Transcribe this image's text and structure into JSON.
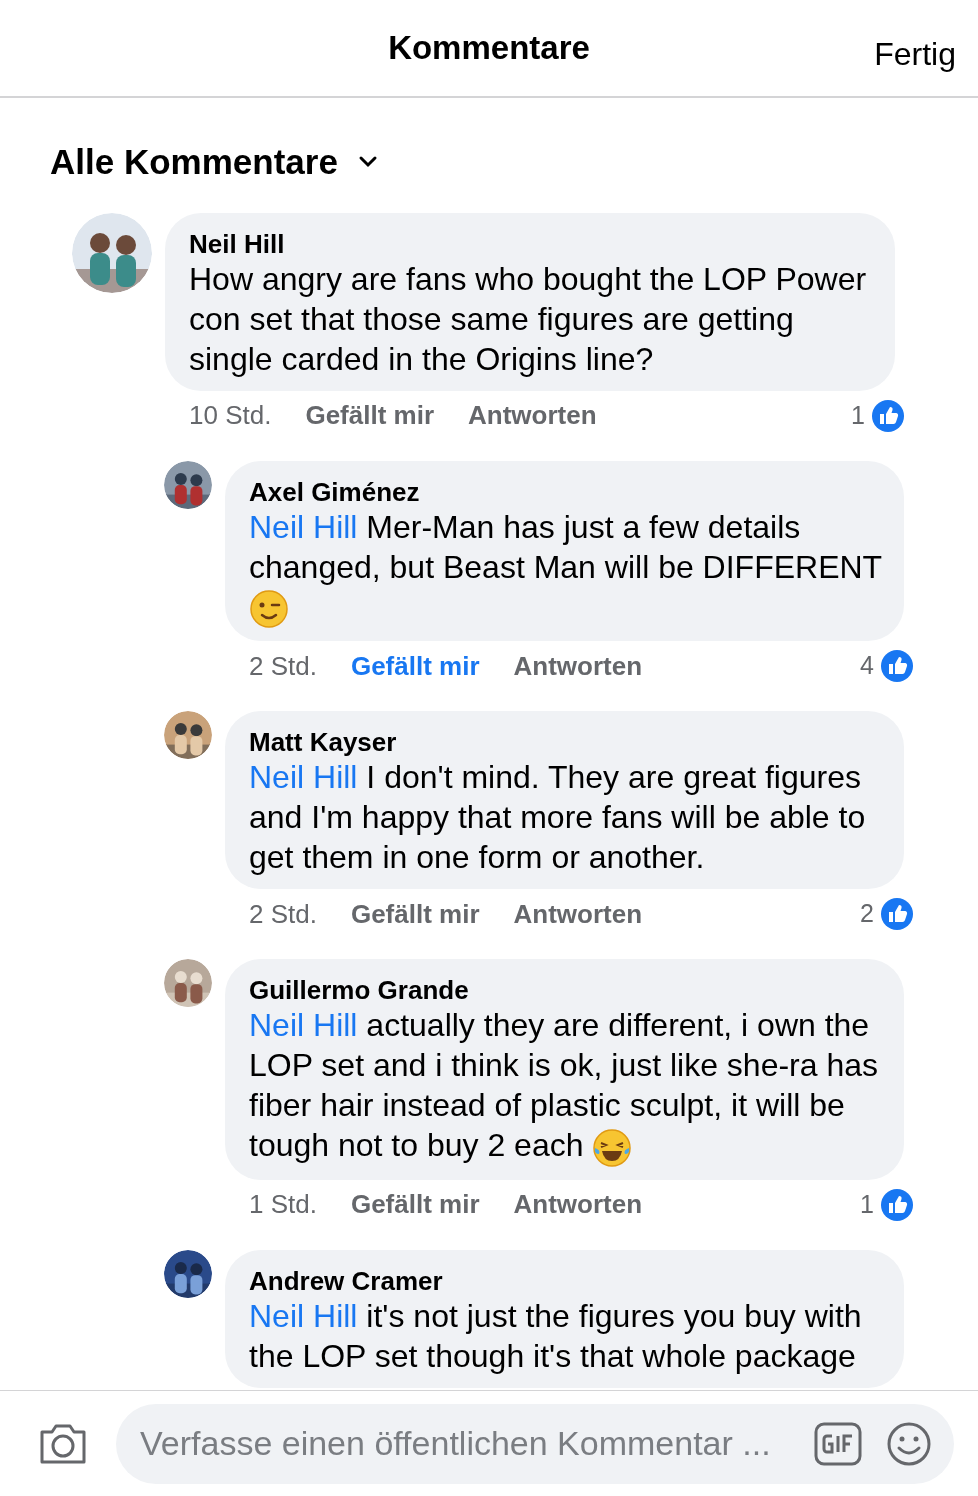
{
  "header": {
    "title": "Kommentare",
    "done": "Fertig"
  },
  "filter": {
    "label": "Alle Kommentare"
  },
  "comments": [
    {
      "author": "Neil Hill",
      "text": "How angry are fans who bought the LOP Power con set that those same figures are getting single carded in the Origins line?",
      "time": "10 Std.",
      "like": "Gefällt mir",
      "liked": false,
      "reply": "Antworten",
      "reactions": "1",
      "replies": [
        {
          "author": "Axel Giménez",
          "mention": "Neil Hill",
          "text": "Mer-Man has just a few details changed, but Beast Man will be DIFFERENT",
          "emoji": {
            "kind": "wink"
          },
          "time": "2 Std.",
          "like": "Gefällt mir",
          "liked": true,
          "reply": "Antworten",
          "reactions": "4"
        },
        {
          "author": "Matt Kayser",
          "mention": "Neil Hill",
          "text": "I don't mind. They are great figures and I'm happy that more fans will be able to get them in one form or another.",
          "time": "2 Std.",
          "like": "Gefällt mir",
          "liked": false,
          "reply": "Antworten",
          "reactions": "2"
        },
        {
          "author": "Guillermo Grande",
          "mention": "Neil Hill",
          "text": "actually they are different, i own the LOP set and i think is ok, just like she-ra has fiber hair instead of plastic sculpt, it will be tough not to buy 2 each",
          "emoji": {
            "kind": "laugh"
          },
          "time": "1 Std.",
          "like": "Gefällt mir",
          "liked": false,
          "reply": "Antworten",
          "reactions": "1"
        },
        {
          "author": "Andrew Cramer",
          "mention": "Neil Hill",
          "text": "it's not just the figures you buy with the LOP set though it's that whole package"
        }
      ]
    }
  ],
  "composer": {
    "placeholder": "Verfasse einen öffentlichen Kommentar ..."
  }
}
